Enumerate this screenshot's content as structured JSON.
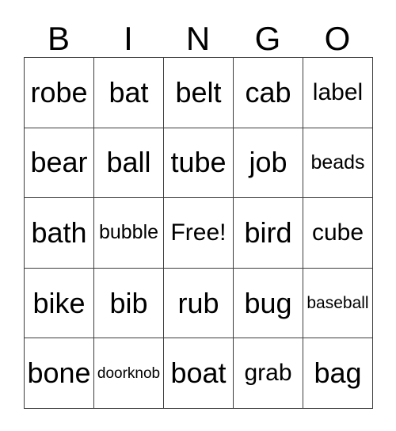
{
  "card": {
    "title": "BINGO",
    "header": {
      "letters": [
        "B",
        "I",
        "N",
        "G",
        "O"
      ]
    },
    "grid": {
      "columns": 5,
      "rows": 5,
      "border_color": "#3d3d3d",
      "text_color": "#000000",
      "background_color": "#ffffff",
      "free_space": {
        "row": 3,
        "column": 3,
        "label": "Free!"
      },
      "cells": [
        [
          {
            "label": "robe",
            "size": "lg"
          },
          {
            "label": "bat",
            "size": "lg"
          },
          {
            "label": "belt",
            "size": "lg"
          },
          {
            "label": "cab",
            "size": "lg"
          },
          {
            "label": "label",
            "size": "md"
          }
        ],
        [
          {
            "label": "bear",
            "size": "lg"
          },
          {
            "label": "ball",
            "size": "lg"
          },
          {
            "label": "tube",
            "size": "lg"
          },
          {
            "label": "job",
            "size": "lg"
          },
          {
            "label": "beads",
            "size": "sm"
          }
        ],
        [
          {
            "label": "bath",
            "size": "lg"
          },
          {
            "label": "bubble",
            "size": "sm"
          },
          {
            "label": "Free!",
            "size": "md"
          },
          {
            "label": "bird",
            "size": "lg"
          },
          {
            "label": "cube",
            "size": "md"
          }
        ],
        [
          {
            "label": "bike",
            "size": "lg"
          },
          {
            "label": "bib",
            "size": "lg"
          },
          {
            "label": "rub",
            "size": "lg"
          },
          {
            "label": "bug",
            "size": "lg"
          },
          {
            "label": "baseball",
            "size": "xs"
          }
        ],
        [
          {
            "label": "bone",
            "size": "lg"
          },
          {
            "label": "doorknob",
            "size": "xxs"
          },
          {
            "label": "boat",
            "size": "lg"
          },
          {
            "label": "grab",
            "size": "md"
          },
          {
            "label": "bag",
            "size": "lg"
          }
        ]
      ]
    }
  }
}
